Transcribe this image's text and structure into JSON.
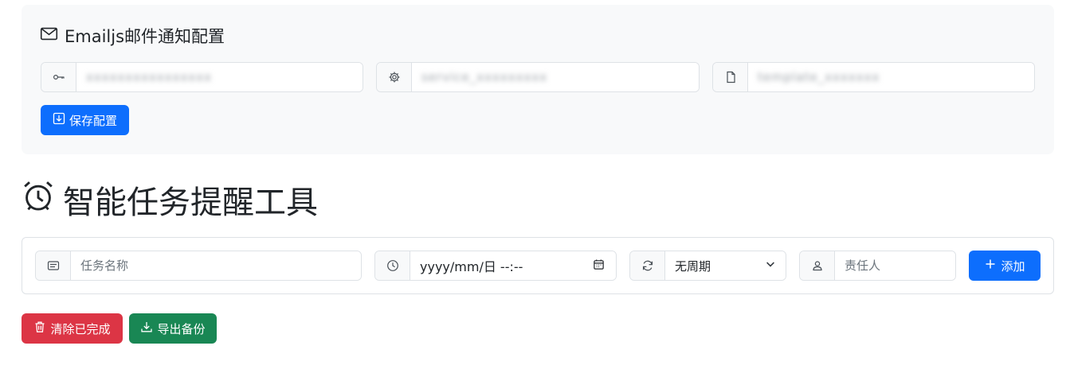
{
  "config": {
    "title": "Emailjs邮件通知配置",
    "service_id_value": "service_xxxxxxxxx",
    "template_id_value": "template_xxxxxxx",
    "public_key_value": "xxxxxxxxxxxxxxxx",
    "save_label": "保存配置"
  },
  "app": {
    "title": "智能任务提醒工具"
  },
  "task_form": {
    "name_placeholder": "任务名称",
    "datetime_value": "yyyy/mm/日 --:--",
    "cycle_selected": "无周期",
    "assignee_placeholder": "责任人",
    "add_label": "添加"
  },
  "actions": {
    "clear_label": "清除已完成",
    "export_label": "导出备份"
  },
  "colors": {
    "primary": "#0d6efd",
    "danger": "#dc3545",
    "success": "#198754",
    "panel_bg": "#f8f9fa",
    "border": "#dee2e6"
  },
  "icons": [
    "envelope-icon",
    "key-icon",
    "gear-icon",
    "file-icon",
    "download-icon",
    "alarm-clock-icon",
    "card-text-icon",
    "clock-icon",
    "refresh-icon",
    "person-icon",
    "plus-icon",
    "trash-icon",
    "calendar-icon",
    "chevron-down-icon"
  ]
}
